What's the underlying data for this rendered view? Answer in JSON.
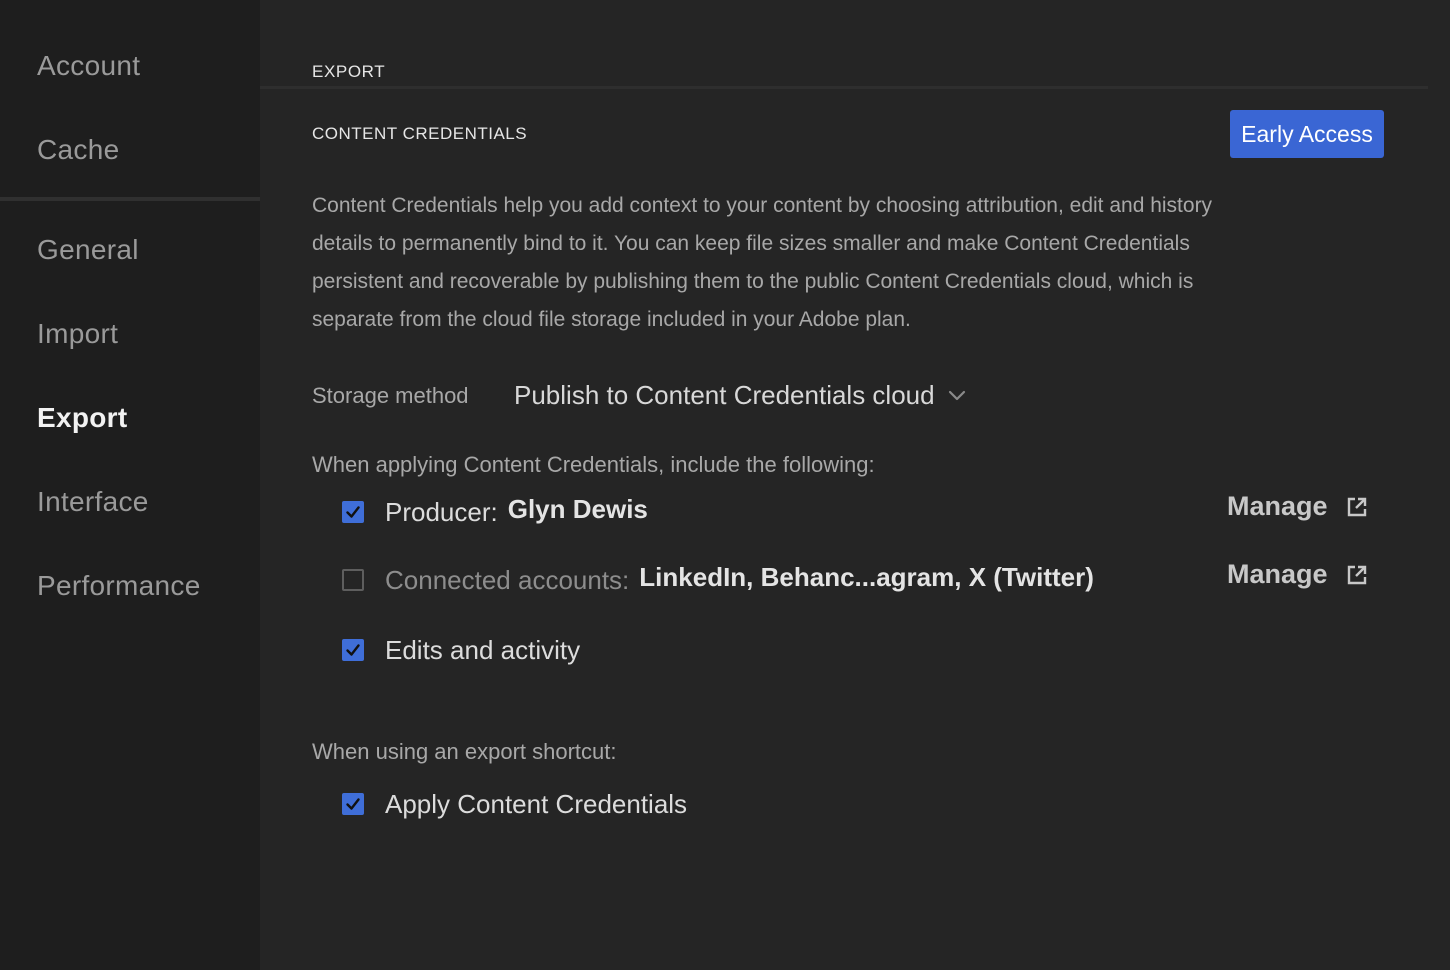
{
  "sidebar": {
    "items": [
      {
        "label": "Account"
      },
      {
        "label": "Cache"
      },
      {
        "label": "General"
      },
      {
        "label": "Import"
      },
      {
        "label": "Export"
      },
      {
        "label": "Interface"
      },
      {
        "label": "Performance"
      }
    ],
    "active": "Export"
  },
  "main": {
    "section_title": "EXPORT",
    "subsection_title": "CONTENT CREDENTIALS",
    "early_access_label": "Early Access",
    "description": "Content Credentials help you add context to your content by choosing attribution, edit and history details to permanently bind to it. You can keep file sizes smaller and make Content Credentials persistent and recoverable by publishing them to the public Content Credentials cloud, which is separate from the cloud file storage included in your Adobe plan.",
    "storage": {
      "label": "Storage method",
      "value": "Publish to Content Credentials cloud"
    },
    "include_label": "When applying Content Credentials, include the following:",
    "options": {
      "producer": {
        "label": "Producer:",
        "value": "Glyn Dewis",
        "checked": true,
        "manage_label": "Manage"
      },
      "connected": {
        "label": "Connected accounts:",
        "value": "LinkedIn, Behanc...agram, X (Twitter)",
        "checked": false,
        "manage_label": "Manage"
      },
      "edits": {
        "label": "Edits and activity",
        "checked": true
      }
    },
    "shortcut_label": "When using an export shortcut:",
    "apply": {
      "label": "Apply Content Credentials",
      "checked": true
    }
  },
  "colors": {
    "accent": "#3a66d4",
    "checkbox": "#3f6ed8",
    "sidebar_bg": "#1e1e1e",
    "main_bg": "#252525"
  }
}
